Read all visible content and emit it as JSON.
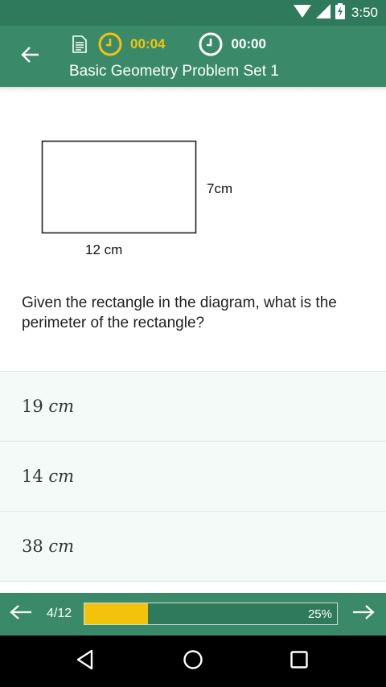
{
  "status_bar": {
    "time": "3:50",
    "icons": [
      "wifi-icon",
      "signal-icon",
      "battery-charging-icon"
    ]
  },
  "header": {
    "elapsed_timer": "00:04",
    "question_timer": "00:00",
    "title": "Basic Geometry Problem Set 1",
    "icons": [
      "back-arrow-icon",
      "document-icon",
      "clock-icon"
    ],
    "accent_color": "#f4c20d",
    "brand_color": "#3a8a6a"
  },
  "diagram": {
    "shape": "rectangle",
    "width_label": "12 cm",
    "height_label": "7cm"
  },
  "question": {
    "text": "Given the rectangle in the diagram, what is the perimeter of the rectangle?"
  },
  "answers": [
    {
      "value": "19",
      "unit": "cm"
    },
    {
      "value": "14",
      "unit": "cm"
    },
    {
      "value": "38",
      "unit": "cm"
    }
  ],
  "footer": {
    "page_counter": "4/12",
    "progress_label": "25%",
    "progress_fraction": 0.25,
    "icons": [
      "prev-arrow-icon",
      "next-arrow-icon"
    ]
  },
  "navigation_bar": {
    "icons": [
      "nav-back-icon",
      "nav-home-icon",
      "nav-recents-icon"
    ]
  }
}
